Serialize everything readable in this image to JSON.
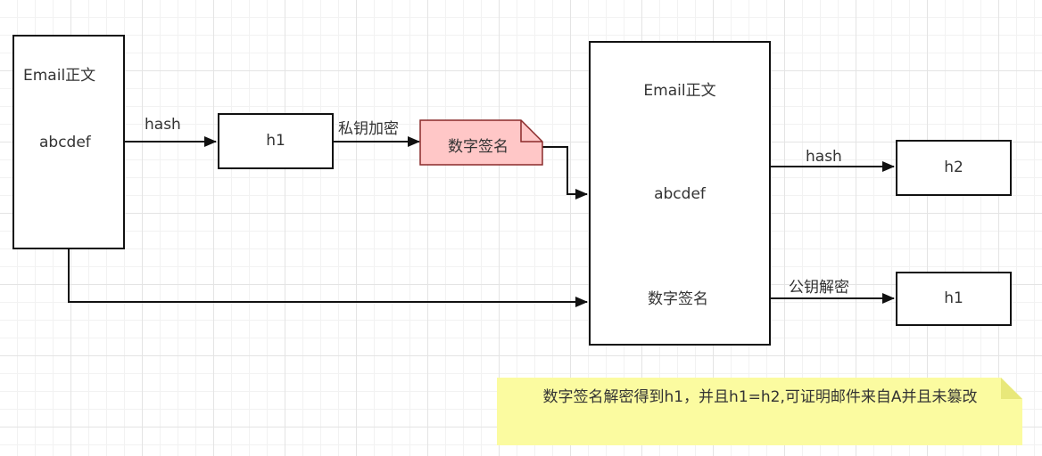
{
  "colors": {
    "stroke": "#111111",
    "signature_fill": "#ffc7c7",
    "signature_stroke": "#8a2a2a",
    "note_fill": "#fbfba0",
    "note_fold": "#e8e87a"
  },
  "left_email": {
    "title": "Email正文",
    "body": "abcdef"
  },
  "right_email": {
    "title": "Email正文",
    "body": "abcdef"
  },
  "nodes": {
    "h1_left": "h1",
    "signature_left": "数字签名",
    "signature_right": "数字签名",
    "h2_right": "h2",
    "h1_right": "h1"
  },
  "edges": {
    "hash_left": "hash",
    "private_key_encrypt": "私钥加密",
    "hash_right": "hash",
    "public_key_decrypt": "公钥解密"
  },
  "note": {
    "text": "数字签名解密得到h1，并且h1=h2,可证明邮件来自A并且未篡改"
  }
}
